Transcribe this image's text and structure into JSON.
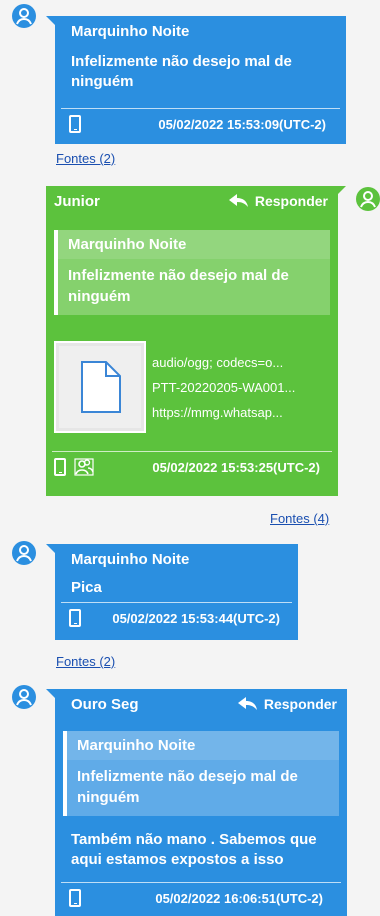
{
  "messages": [
    {
      "sender": "Marquinho Noite",
      "text": "Infelizmente não desejo mal de ninguém",
      "timestamp": "05/02/2022 15:53:09(UTC-2)",
      "sources_link": "Fontes (2)"
    },
    {
      "sender": "Junior",
      "reply_label": "Responder",
      "quoted_sender": "Marquinho Noite",
      "quoted_text": "Infelizmente não desejo mal de ninguém",
      "attachment": {
        "mime": "audio/ogg; codecs=o...",
        "filename": "PTT-20220205-WA001...",
        "url": "https://mmg.whatsap..."
      },
      "timestamp": "05/02/2022 15:53:25(UTC-2)",
      "sources_link": "Fontes (4)"
    },
    {
      "sender": "Marquinho Noite",
      "text": "Pica",
      "timestamp": "05/02/2022 15:53:44(UTC-2)",
      "sources_link": "Fontes (2)"
    },
    {
      "sender": "Ouro Seg",
      "reply_label": "Responder",
      "quoted_sender": "Marquinho Noite",
      "quoted_text": "Infelizmente não desejo mal de ninguém",
      "text": "Também não mano . Sabemos que aqui estamos expostos a isso",
      "timestamp": "05/02/2022 16:06:51(UTC-2)"
    }
  ],
  "colors": {
    "incoming": "#2b8fe0",
    "outgoing": "#5cc23d",
    "link": "#1a4fb0",
    "background": "#f4f4f4"
  },
  "icons": {
    "avatar": "user-icon",
    "device": "phone-icon",
    "group": "group-icon",
    "reply": "reply-arrow-icon",
    "file": "document-icon"
  }
}
